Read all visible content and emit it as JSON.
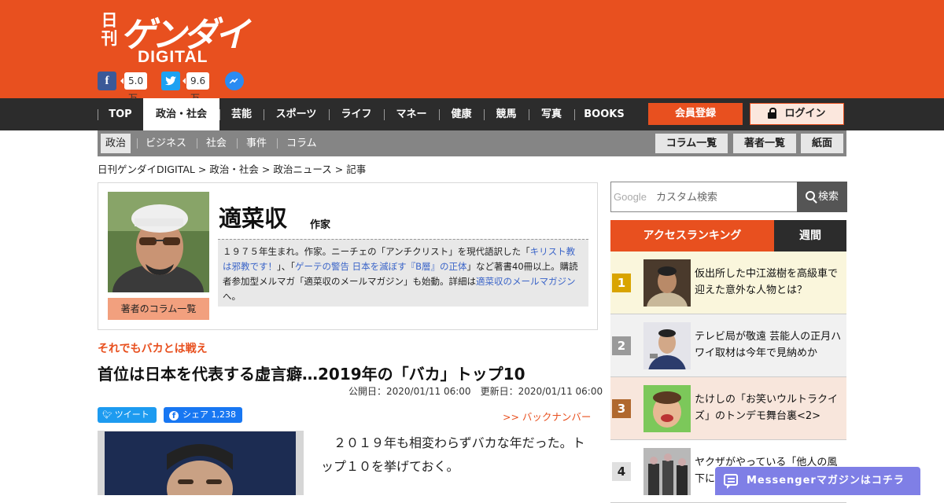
{
  "header": {
    "logo_nikkan": "日刊",
    "logo_main": "ゲンダイ",
    "logo_sub": "DIGITAL",
    "facebook_count": "5.0万",
    "twitter_count": "9.6万",
    "brand_color": "#e8501f"
  },
  "nav": {
    "items": [
      "TOP",
      "政治・社会",
      "芸能",
      "スポーツ",
      "ライフ",
      "マネー",
      "健康",
      "競馬",
      "写真",
      "BOOKS"
    ],
    "active": "政治・社会",
    "register_label": "会員登録",
    "login_label": "ログイン"
  },
  "subnav": {
    "items": [
      "政治",
      "ビジネス",
      "社会",
      "事件",
      "コラム"
    ],
    "active": "政治",
    "buttons": [
      "コラム一覧",
      "著者一覧",
      "紙面"
    ]
  },
  "breadcrumb": [
    "日刊ゲンダイDIGITAL",
    ">",
    "政治・社会",
    ">",
    "政治ニュース",
    ">",
    "記事"
  ],
  "author": {
    "name": "適菜収",
    "role": "作家",
    "columns_button": "著者のコラム一覧",
    "bio_1": "１９７５年生まれ。作家。ニーチェの「アンチクリスト」を現代語訳した「",
    "bio_link_1": "キリスト教は邪教です！",
    "bio_2": "」、「",
    "bio_link_2": "ゲーテの警告 日本を滅ぼす『B層』の正体",
    "bio_3": "」など著書40冊以上。購読者参加型メルマガ「適菜収のメールマガジン」も始動。詳細は",
    "bio_link_3": "適菜収のメールマガジン",
    "bio_4": "へ。"
  },
  "article": {
    "kicker": "それでもバカとは戦え",
    "title": "首位は日本を代表する虚言癖…2019年の「バカ」トップ10",
    "published": "公開日：2020/01/11 06:00",
    "updated": "更新日：2020/01/11 06:00",
    "tweet_label": "ツイート",
    "share_label": "シェア 1,238",
    "backnumber_label": ">> バックナンバー",
    "body": "　２０１９年も相変わらずバカな年だった。トップ１０を挙げておく。"
  },
  "sidebar": {
    "search_placeholder": "カスタム検索",
    "search_brand": "Google",
    "search_button": "検索",
    "tab_access": "アクセスランキング",
    "tab_weekly": "週間",
    "ranking": [
      {
        "rank": "1",
        "title": "仮出所した中江滋樹を高級車で迎えた意外な人物とは？",
        "badge_color": "#d9a400"
      },
      {
        "rank": "2",
        "title": "テレビ局が敬遠 芸能人の正月ハワイ取材は今年で見納めか",
        "badge_color": "#9a9a9a"
      },
      {
        "rank": "3",
        "title": "たけしの「お笑いウルトラクイズ」のトンデモ舞台裏<2>",
        "badge_color": "#b0682e"
      },
      {
        "rank": "4",
        "title": "ヤクザがやっている「他人の風下に",
        "badge_color": "#e0e0e0"
      }
    ]
  },
  "messenger_banner": "Messengerマガジンはコチラ"
}
